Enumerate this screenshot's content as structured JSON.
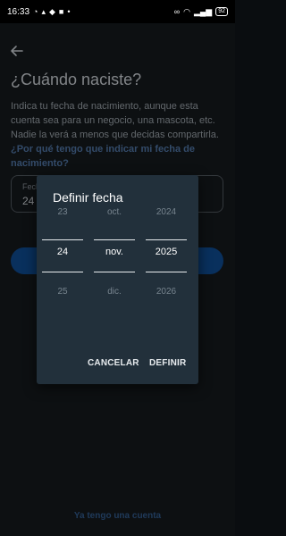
{
  "status_bar": {
    "time": "16:33",
    "battery": "92"
  },
  "page": {
    "title": "¿Cuándo naciste?",
    "description": "Indica tu fecha de nacimiento, aunque esta cuenta sea para un negocio, una mascota, etc. Nadie la verá a menos que decidas compartirla.",
    "help_link": "¿Por qué tengo que indicar mi fecha de nacimiento?",
    "field_label": "Fech",
    "field_value": "24 d",
    "have_account": "Ya tengo una cuenta"
  },
  "dialog": {
    "title": "Definir fecha",
    "day": {
      "prev": "23",
      "selected": "24",
      "next": "25"
    },
    "month": {
      "prev": "oct.",
      "selected": "nov.",
      "next": "dic."
    },
    "year": {
      "prev": "2024",
      "selected": "2025",
      "next": "2026"
    },
    "cancel_label": "CANCELAR",
    "ok_label": "DEFINIR"
  },
  "colors": {
    "accent": "#0f4a8f",
    "link": "#4f74a3",
    "dialog_bg": "#22303b"
  },
  "icons": [
    "whatsapp-icon",
    "chat-icon",
    "message-icon",
    "square-icon",
    "dot-icon",
    "link-icon",
    "wifi-icon",
    "signal-icon",
    "battery-icon",
    "back-arrow-icon"
  ]
}
